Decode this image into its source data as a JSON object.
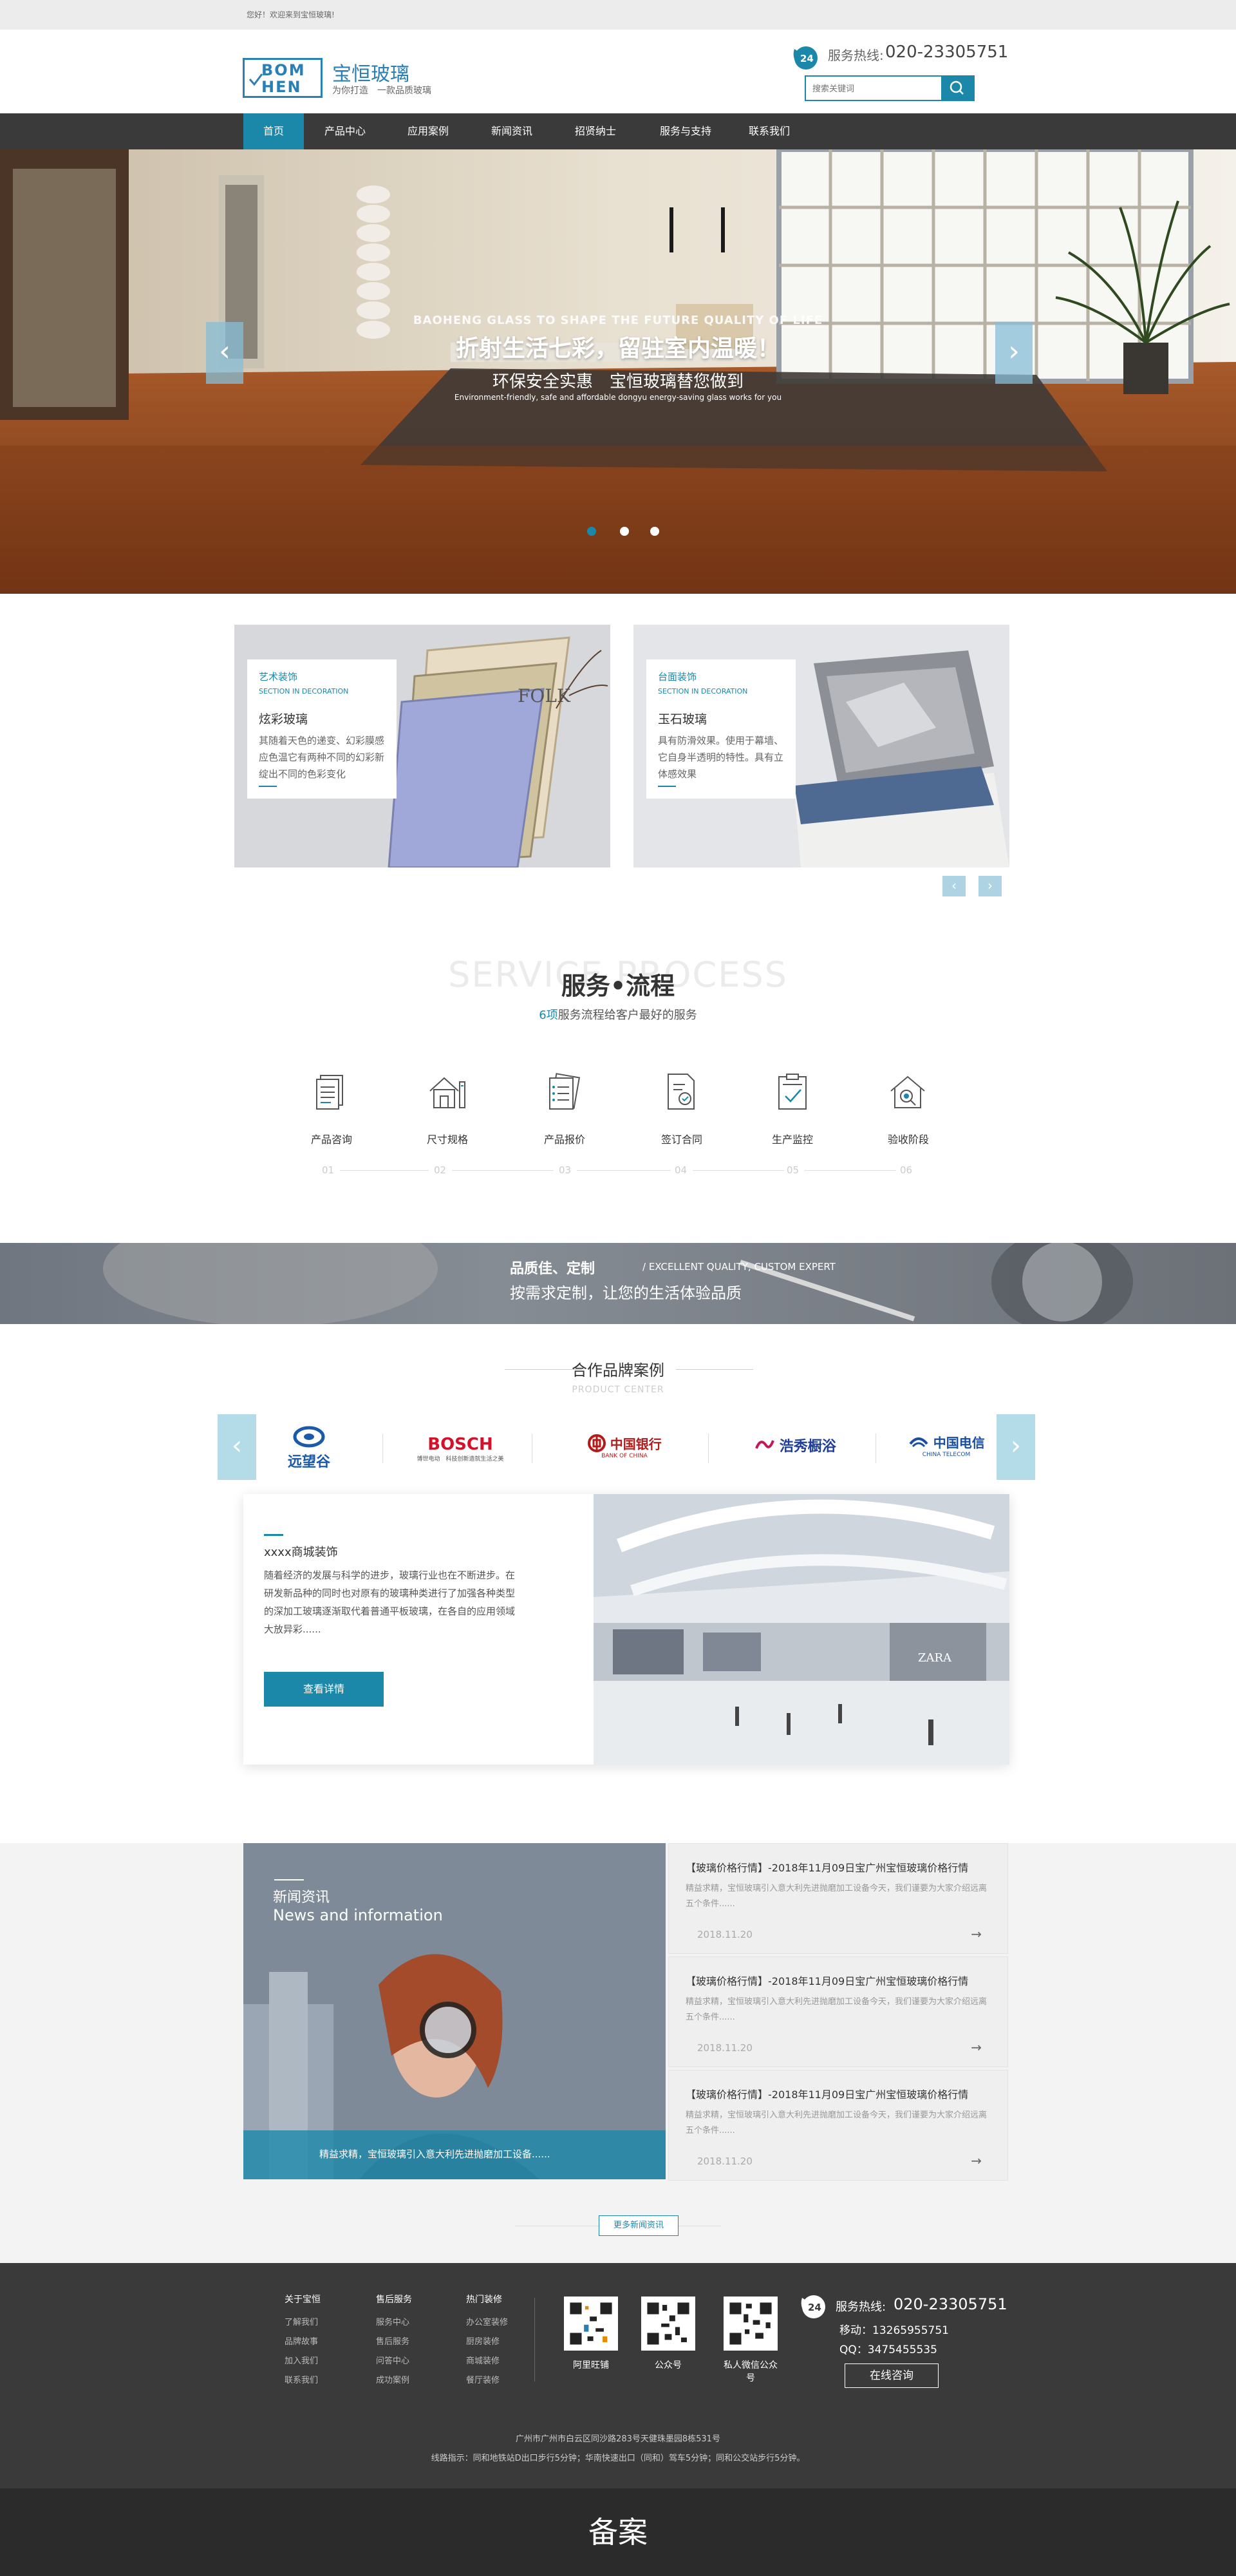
{
  "topbar": {
    "welcome": "您好！欢迎来到宝恒玻璃!"
  },
  "header": {
    "logo_line1": "BOM",
    "logo_line2": "HEN",
    "brand_name": "宝恒玻璃",
    "slogan": "为你打造　一款品质玻璃",
    "hotline_label": "服务热线:",
    "hotline_number": "020-23305751",
    "search_placeholder": "搜索关键词"
  },
  "nav": {
    "items": [
      "首页",
      "产品中心",
      "应用案例",
      "新闻资讯",
      "招贤纳士",
      "服务与支持",
      "联系我们"
    ]
  },
  "banner": {
    "en_title": "BAOHENG GLASS TO SHAPE THE FUTURE QUALITY OF LIFE",
    "headline": "折射生活七彩，留驻室内温暖！",
    "subline": "环保安全实惠　宝恒玻璃替您做到",
    "en_sub": "Environment-friendly, safe and affordable dongyu energy-saving glass works for you",
    "prev_glyph": "‹",
    "next_glyph": "›",
    "dots": 3,
    "active_dot": 0
  },
  "cards": [
    {
      "tag": "艺术装饰",
      "tag_en": "SECTION IN DECORATION",
      "name": "炫彩玻璃",
      "desc": "其随着天色的递变、幻彩膜感应色温它有两种不同的幻彩新绽出不同的色彩变化",
      "photo_text": "FOLK"
    },
    {
      "tag": "台面装饰",
      "tag_en": "SECTION IN DECORATION",
      "name": "玉石玻璃",
      "desc": "具有防滑效果。使用于幕墙、它自身半透明的特性。具有立体感效果"
    }
  ],
  "cards_nav": {
    "prev": "‹",
    "next": "›"
  },
  "service": {
    "title_en": "SERVICE PROCESS",
    "title_cn": "服务•流程",
    "sub_highlight": "6项",
    "sub_rest": "服务流程给客户最好的服务",
    "steps": [
      {
        "label": "产品咨询",
        "num": "01",
        "icon": "document-icon"
      },
      {
        "label": "尺寸规格",
        "num": "02",
        "icon": "house-icon"
      },
      {
        "label": "产品报价",
        "num": "03",
        "icon": "checklist-icon"
      },
      {
        "label": "签订合同",
        "num": "04",
        "icon": "contract-icon"
      },
      {
        "label": "生产监控",
        "num": "05",
        "icon": "clipboard-check-icon"
      },
      {
        "label": "验收阶段",
        "num": "06",
        "icon": "inspect-house-icon"
      }
    ]
  },
  "quality": {
    "cn": "品质佳、定制",
    "en": "/ EXCELLENT QUALITY, CUSTOM EXPERT",
    "line2": "按需求定制，让您的生活体验品质"
  },
  "partners": {
    "title": "合作品牌案例",
    "title_en": "PRODUCT CENTER",
    "brands": [
      "远望谷",
      "BOSCH",
      "中国银行",
      "浩秀橱浴",
      "中国电信"
    ],
    "brand_subs": [
      "",
      "博世电动　科技创新造就生活之美",
      "BANK OF CHINA",
      "",
      "CHINA TELECOM"
    ],
    "brand_colors": [
      "#1a5aa8",
      "#d3112b",
      "#b31b1b",
      "#1f3f9a",
      "#1a4ea0"
    ],
    "prev": "‹",
    "next": "›"
  },
  "case": {
    "title": "xxxx商城装饰",
    "desc": "随着经济的发展与科学的进步，玻璃行业也在不断进步。在研发新品种的同时也对原有的玻璃种类进行了加强各种类型的深加工玻璃逐渐取代着普通平板玻璃，在各自的应用领域大放异彩......",
    "button": "查看详情",
    "photo_sign": "ZARA"
  },
  "news": {
    "title_cn": "新闻资讯",
    "title_en": "News and information",
    "caption": "精益求精，宝恒玻璃引入意大利先进抛磨加工设备......",
    "items": [
      {
        "title": "【玻璃价格行情】-2018年11月09日宝广州宝恒玻璃价格行情",
        "desc": "精益求精，宝恒玻璃引入意大利先进抛磨加工设备今天，我们谨要为大家介绍远离五个条件......",
        "date": "2018.11.20"
      },
      {
        "title": "【玻璃价格行情】-2018年11月09日宝广州宝恒玻璃价格行情",
        "desc": "精益求精，宝恒玻璃引入意大利先进抛磨加工设备今天，我们谨要为大家介绍远离五个条件......",
        "date": "2018.11.20"
      },
      {
        "title": "【玻璃价格行情】-2018年11月09日宝广州宝恒玻璃价格行情",
        "desc": "精益求精，宝恒玻璃引入意大利先进抛磨加工设备今天，我们谨要为大家介绍远离五个条件......",
        "date": "2018.11.20"
      }
    ],
    "arrow": "→",
    "more": "更多新闻资讯"
  },
  "footer": {
    "cols": [
      {
        "head": "关于宝恒",
        "links": [
          "了解我们",
          "品牌故事",
          "加入我们",
          "联系我们"
        ]
      },
      {
        "head": "售后服务",
        "links": [
          "服务中心",
          "售后服务",
          "问答中心",
          "成功案例"
        ]
      },
      {
        "head": "热门装修",
        "links": [
          "办公室装修",
          "厨房装修",
          "商城装修",
          "餐厅装修"
        ]
      }
    ],
    "qrs": [
      "阿里旺铺",
      "公众号",
      "私人微信公众号"
    ],
    "hotline_label": "服务热线:",
    "hotline": "020-23305751",
    "mobile": "移动：13265955751",
    "qq": "QQ：3475455535",
    "consult": "在线咨询",
    "address": "广州市广州市白云区同沙路283号天健珠墨园8栋531号",
    "route": "线路指示：同和地铁站D出口步行5分钟；华南快速出口（同和）驾车5分钟；同和公交站步行5分钟。"
  },
  "beian": {
    "text": "备案"
  },
  "colors": {
    "accent": "#1b88aa",
    "nav_bg": "#3a3a3a",
    "footer_bg": "#3a3a3a"
  }
}
